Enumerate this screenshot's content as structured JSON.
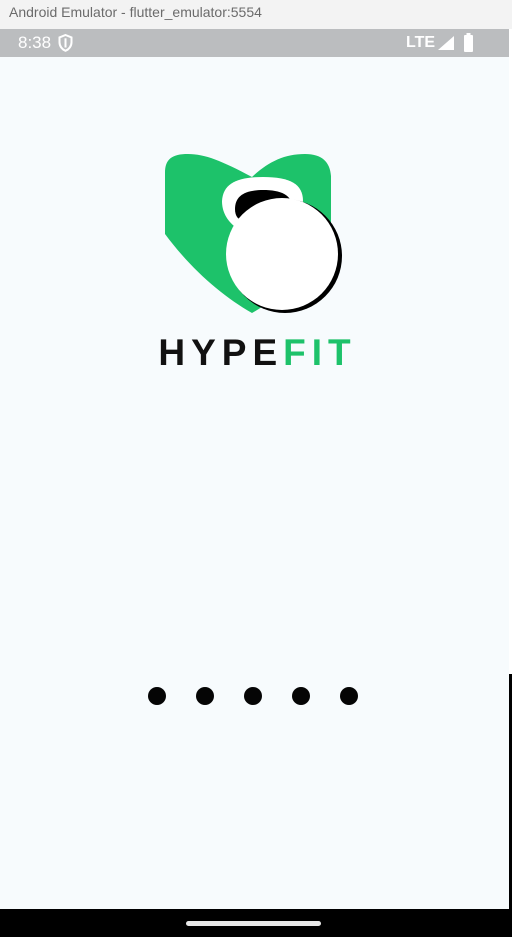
{
  "window": {
    "title": "Android Emulator - flutter_emulator:5554"
  },
  "status_bar": {
    "time": "8:38",
    "network": "LTE",
    "icons": [
      "shield-icon",
      "signal-icon",
      "battery-icon"
    ]
  },
  "splash": {
    "brand_part_a": "HYPE",
    "brand_part_b": "FIT",
    "logo_icon": "heart-kettlebell-logo",
    "loading_indicator": "five-dot-loader",
    "accent_color": "#1dc26a",
    "background_color": "#f7fbfd"
  },
  "nav_bar": {
    "home_handle": "gesture-home-handle"
  }
}
